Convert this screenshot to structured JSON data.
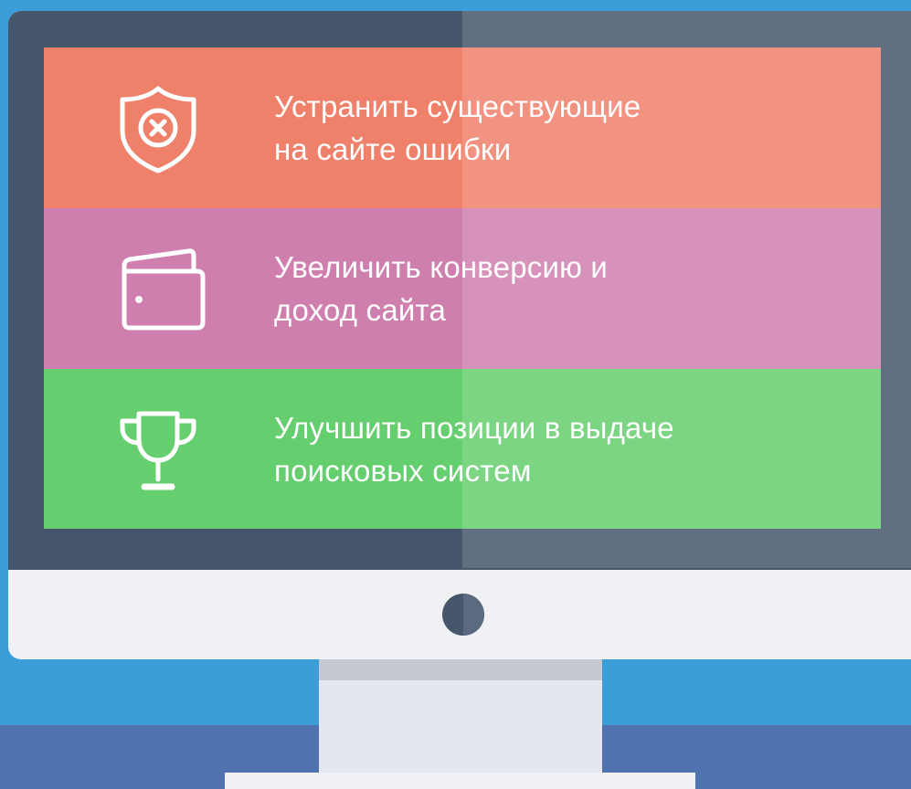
{
  "colors": {
    "background": "#3c9ed8",
    "floor": "#5073b0",
    "bezel": "#46566b",
    "row_error": "#ef806a",
    "row_wallet": "#cf7fae",
    "row_trophy": "#65ce6e",
    "text": "#ffffff"
  },
  "items": [
    {
      "icon": "shield-x-icon",
      "line1": "Устранить существующие",
      "line2": "на сайте ошибки"
    },
    {
      "icon": "wallet-icon",
      "line1": "Увеличить конверсию и",
      "line2": "доход сайта"
    },
    {
      "icon": "trophy-icon",
      "line1": "Улучшить позиции в выдаче",
      "line2": "поисковых систем"
    }
  ]
}
